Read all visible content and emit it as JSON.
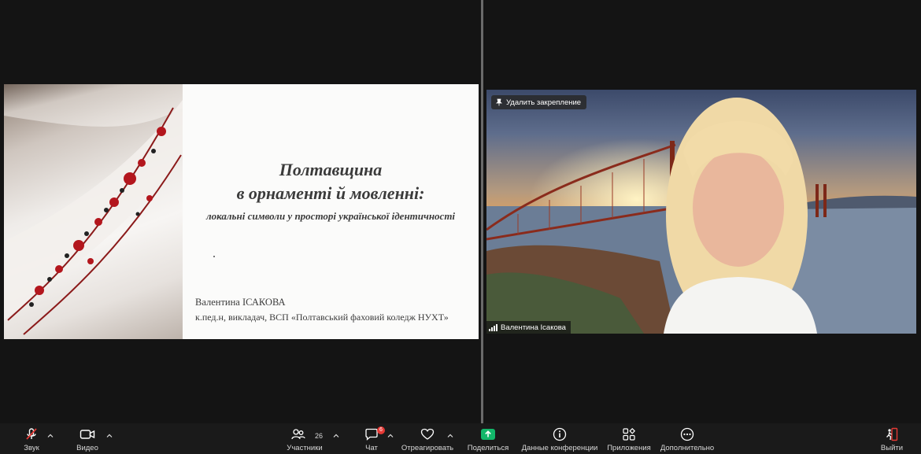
{
  "slide": {
    "title_line1": "Полтавщина",
    "title_line2": "в орнаменті й мовленні:",
    "subtitle": "локальні символи у просторі української ідентичності",
    "author_name": "Валентина ІСАКОВА",
    "author_details": "к.пед.н, викладач, ВСП «Полтавський фаховий коледж НУХТ»"
  },
  "video": {
    "unpin_label": "Удалить закрепление",
    "participant_name": "Валентина Ісакова"
  },
  "toolbar": {
    "audio_label": "Звук",
    "video_label": "Видео",
    "participants_label": "Участники",
    "participants_count": "26",
    "chat_label": "Чат",
    "chat_badge": "6",
    "react_label": "Отреагировать",
    "share_label": "Поделиться",
    "info_label": "Данные конференции",
    "apps_label": "Приложения",
    "more_label": "Дополнительно",
    "leave_label": "Выйти"
  },
  "colors": {
    "share_green": "#12b76a",
    "badge_red": "#e53935",
    "mute_red": "#e53935"
  }
}
